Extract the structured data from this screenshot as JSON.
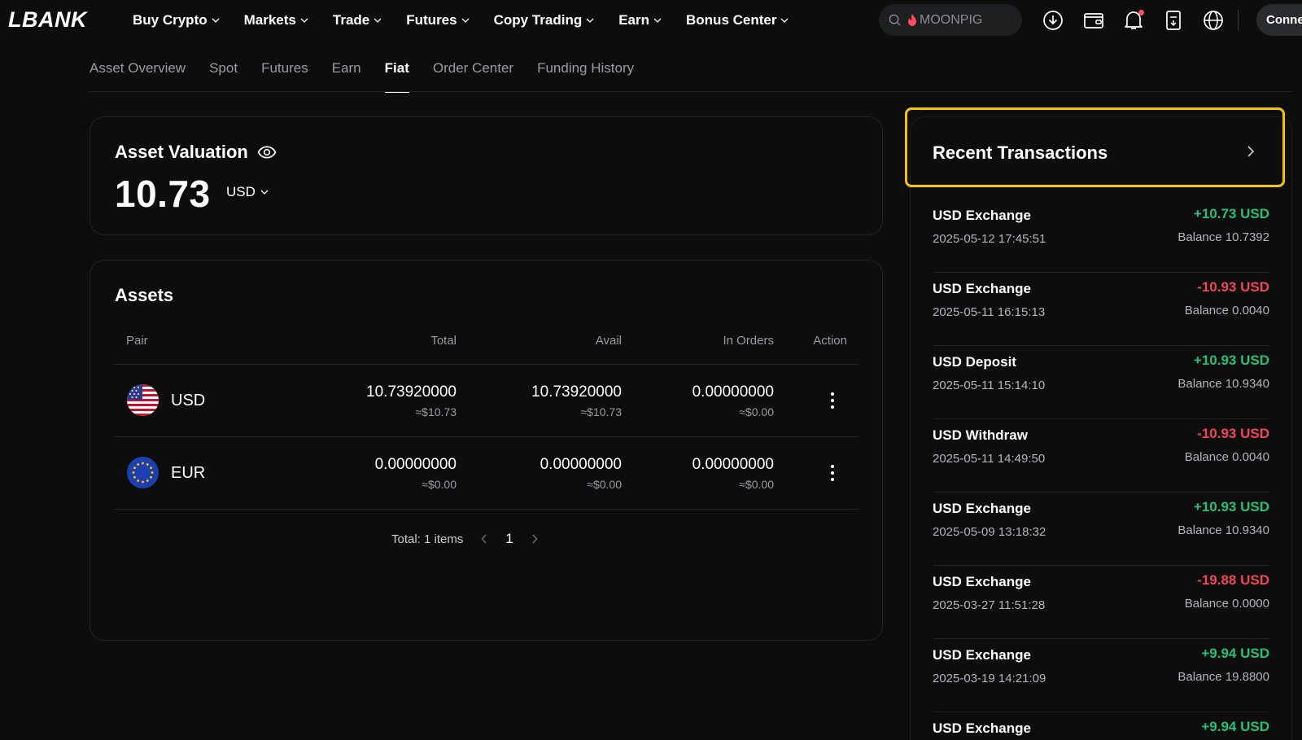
{
  "brand": "LBANK",
  "nav": {
    "menu": [
      {
        "label": "Buy Crypto"
      },
      {
        "label": "Markets"
      },
      {
        "label": "Trade"
      },
      {
        "label": "Futures"
      },
      {
        "label": "Copy Trading"
      },
      {
        "label": "Earn"
      },
      {
        "label": "Bonus Center"
      }
    ],
    "search_placeholder": "MOONPIG",
    "connect_label": "Conne"
  },
  "subtabs": [
    {
      "label": "Asset Overview",
      "active": false
    },
    {
      "label": "Spot",
      "active": false
    },
    {
      "label": "Futures",
      "active": false
    },
    {
      "label": "Earn",
      "active": false
    },
    {
      "label": "Fiat",
      "active": true
    },
    {
      "label": "Order Center",
      "active": false
    },
    {
      "label": "Funding History",
      "active": false
    }
  ],
  "valuation": {
    "title": "Asset Valuation",
    "amount": "10.73",
    "currency": "USD"
  },
  "assets": {
    "title": "Assets",
    "columns": {
      "pair": "Pair",
      "total": "Total",
      "avail": "Avail",
      "in_orders": "In Orders",
      "action": "Action"
    },
    "rows": [
      {
        "pair": "USD",
        "flag": "us-flag-icon",
        "total": "10.73920000",
        "total_usd": "≈$10.73",
        "avail": "10.73920000",
        "avail_usd": "≈$10.73",
        "in_orders": "0.00000000",
        "in_orders_usd": "≈$0.00"
      },
      {
        "pair": "EUR",
        "flag": "eu-flag-icon",
        "total": "0.00000000",
        "total_usd": "≈$0.00",
        "avail": "0.00000000",
        "avail_usd": "≈$0.00",
        "in_orders": "0.00000000",
        "in_orders_usd": "≈$0.00"
      }
    ],
    "pagination": {
      "total_label": "Total: 1 items",
      "current_page": "1"
    }
  },
  "recent_transactions": {
    "title": "Recent Transactions",
    "items": [
      {
        "type": "USD Exchange",
        "date": "2025-05-12 17:45:51",
        "amount": "+10.73 USD",
        "direction": "pos",
        "balance": "Balance 10.7392"
      },
      {
        "type": "USD Exchange",
        "date": "2025-05-11 16:15:13",
        "amount": "-10.93 USD",
        "direction": "neg",
        "balance": "Balance 0.0040"
      },
      {
        "type": "USD Deposit",
        "date": "2025-05-11 15:14:10",
        "amount": "+10.93 USD",
        "direction": "pos",
        "balance": "Balance 10.9340"
      },
      {
        "type": "USD Withdraw",
        "date": "2025-05-11 14:49:50",
        "amount": "-10.93 USD",
        "direction": "neg",
        "balance": "Balance 0.0040"
      },
      {
        "type": "USD Exchange",
        "date": "2025-05-09 13:18:32",
        "amount": "+10.93 USD",
        "direction": "pos",
        "balance": "Balance 10.9340"
      },
      {
        "type": "USD Exchange",
        "date": "2025-03-27 11:51:28",
        "amount": "-19.88 USD",
        "direction": "neg",
        "balance": "Balance 0.0000"
      },
      {
        "type": "USD Exchange",
        "date": "2025-03-19 14:21:09",
        "amount": "+9.94 USD",
        "direction": "pos",
        "balance": "Balance 19.8800"
      },
      {
        "type": "USD Exchange",
        "date": "",
        "amount": "+9.94 USD",
        "direction": "pos",
        "balance": ""
      }
    ]
  },
  "colors": {
    "background": "#0d0d0e",
    "positive": "#22c17a",
    "negative": "#f0455b",
    "highlight": "#f5c400",
    "muted_text": "#9a9ca1"
  }
}
